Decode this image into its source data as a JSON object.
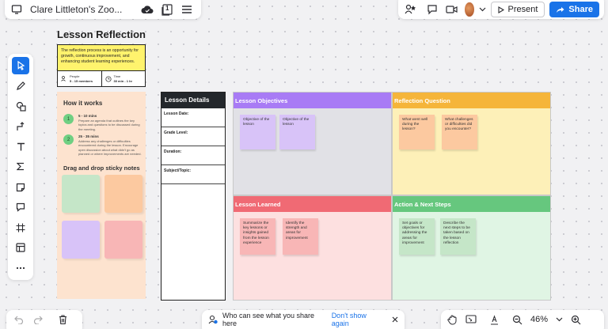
{
  "topbar": {
    "board_title": "Clare Littleton's Zoo...",
    "present_label": "Present",
    "share_label": "Share",
    "page_count": "1"
  },
  "bottom": {
    "privacy_text": "Who can see what you share here",
    "dont_show_label": "Don't show again",
    "zoom_level": "46%"
  },
  "template": {
    "title": "Lesson Reflection",
    "intro": "The reflection process is an opportunity for growth, continuous improvement, and enhancing student learning experiences.",
    "people_label": "People",
    "people_value": "5 - 15 members",
    "time_label": "Time",
    "time_value": "30 min - 1 hr",
    "how_heading": "How it works",
    "steps": [
      {
        "num": "1",
        "time": "5 - 10 mins",
        "text": "Prepare an agenda that outlines the key topics and questions to be discussed during the meeting."
      },
      {
        "num": "2",
        "time": "25 - 35 mins",
        "text": "Address any challenges or difficulties encountered during the lesson. Encourage open discussion about what didn't go as planned or where improvements are needed."
      }
    ],
    "drag_heading": "Drag and drop sticky notes",
    "details": {
      "heading": "Lesson Details",
      "fields": [
        "Lesson Date:",
        "Grade Level:",
        "Duration:",
        "Subject/Topic:"
      ]
    },
    "quadrants": {
      "objectives": {
        "title": "Lesson Objectives",
        "notes": [
          "Objective of the lesson",
          "Objective of the lesson"
        ]
      },
      "reflection": {
        "title": "Reflection Question",
        "notes": [
          "What went well during the lesson?",
          "What challenges or difficulties did you encounter?"
        ]
      },
      "learned": {
        "title": "Lesson Learned",
        "notes": [
          "Summarize the key lessons or insights gained from the lesson experience",
          "Identify the strength and areas for improvement"
        ]
      },
      "actions": {
        "title": "Action & Next Steps",
        "notes": [
          "Set goals or objectives for addressing the areas for improvement",
          "Describe the next steps to be taken based on the lesson reflection"
        ]
      }
    }
  },
  "colors": {
    "accent": "#1a73e8",
    "objectives_header": "#a87bf5",
    "objectives_bg": "#e1e1e6",
    "reflection_header": "#f5b53a",
    "reflection_bg": "#fdf0b8",
    "learned_header": "#f06a74",
    "learned_bg": "#fde0e0",
    "actions_header": "#66c77e",
    "actions_bg": "#e0f5e4"
  }
}
